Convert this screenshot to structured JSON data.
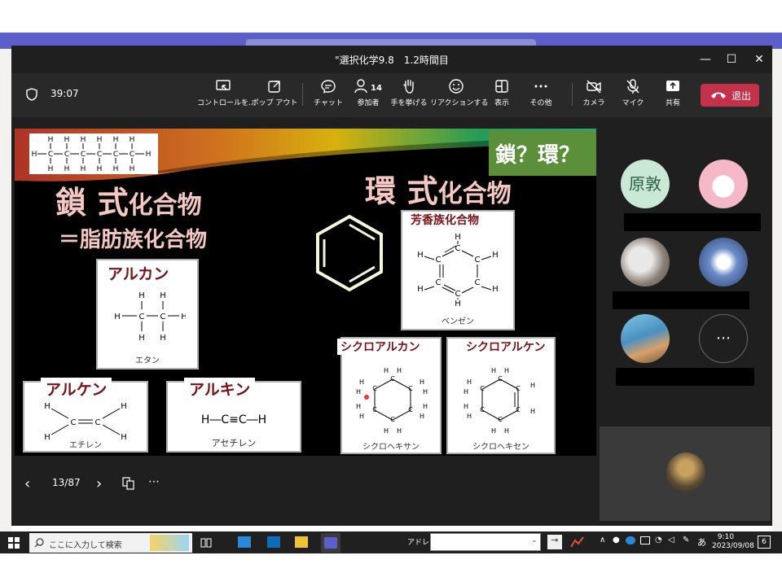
{
  "window": {
    "title": "\"選択化学9.8　1.2時間目"
  },
  "meeting": {
    "timer": "39:07",
    "participants_count": "14"
  },
  "toolbar": {
    "buttons": [
      {
        "label": "コントロールを…",
        "icon": "share-control-icon"
      },
      {
        "label": "ポップ アウト",
        "icon": "popout-icon"
      },
      {
        "label": "チャット",
        "icon": "chat-icon"
      },
      {
        "label": "参加者",
        "icon": "participants-icon"
      },
      {
        "label": "手を挙げる",
        "icon": "raise-hand-icon"
      },
      {
        "label": "リアクションする",
        "icon": "reaction-icon"
      },
      {
        "label": "表示",
        "icon": "view-icon"
      },
      {
        "label": "その他",
        "icon": "more-icon"
      },
      {
        "label": "カメラ",
        "icon": "camera-off-icon"
      },
      {
        "label": "マイク",
        "icon": "mic-off-icon"
      },
      {
        "label": "共有",
        "icon": "share-icon"
      }
    ],
    "leave_label": "退出"
  },
  "slide": {
    "question": "鎖？環？",
    "chain_title_a": "鎖",
    "chain_title_b": "式",
    "chain_title_c": "化合物",
    "chain_subtitle": "＝脂肪族化合物",
    "ring_title_a": "環",
    "ring_title_b": "式",
    "ring_title_c": "化合物",
    "boxes": {
      "alkane": {
        "heading": "アルカン",
        "caption": "エタン"
      },
      "alkene": {
        "heading": "アルケン",
        "caption": "エチレン"
      },
      "alkyne": {
        "heading": "アルキン",
        "caption": "アセチレン",
        "formula": "H―C≡C―H"
      },
      "aromatic": {
        "heading": "芳香族化合物",
        "caption": "ベンゼン"
      },
      "cycloalkane": {
        "heading": "シクロアルカン",
        "caption": "シクロヘキサン"
      },
      "cycloalkene": {
        "heading": "シクロアルケン",
        "caption": "シクロヘキセン"
      }
    }
  },
  "slide_controls": {
    "page": "13/87"
  },
  "participants": {
    "tile1_initials": "原敦"
  },
  "taskbar": {
    "search_placeholder": "ここに入力して検索",
    "address_label": "アドレス",
    "ime": "あ",
    "time": "9:10",
    "date": "2023/09/08",
    "notif_count": "6"
  },
  "colors": {
    "leave_button": "#c4314b",
    "slide_title": "#f4c7c3",
    "heading_dark_red": "#7b1017",
    "question_box": "#5b8f3a",
    "teams_purple": "#5b5fc7"
  }
}
